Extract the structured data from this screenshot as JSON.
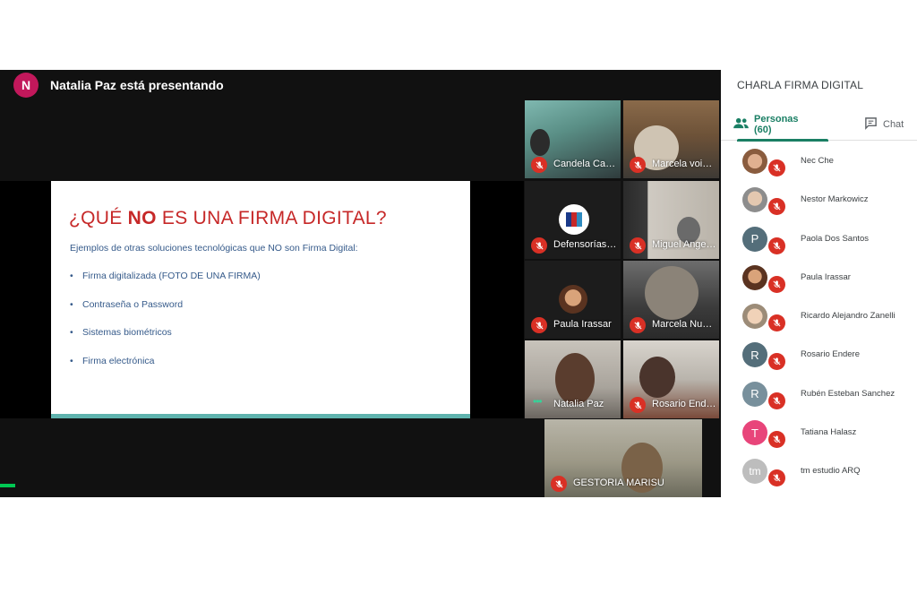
{
  "presenter": {
    "initial": "N",
    "text": "Natalia Paz está presentando",
    "avatar_color": "#c2185b"
  },
  "slide": {
    "title_prefix": "¿QUÉ ",
    "title_bold": "NO",
    "title_suffix": " ES UNA FIRMA DIGITAL?",
    "subtitle": "Ejemplos de otras soluciones tecnológicas que NO son Firma Digital:",
    "bullets": [
      "Firma digitalizada (FOTO DE UNA FIRMA)",
      "Contraseña o Password",
      "Sistemas biométricos",
      "Firma electrónica"
    ],
    "title_color": "#c62828",
    "text_color": "#355a8a",
    "footer_color": "#5fb3ae"
  },
  "tiles": [
    {
      "name": "Candela Castr...",
      "muted": true
    },
    {
      "name": "Marcela voisc...",
      "muted": true
    },
    {
      "name": "Defensorías O...",
      "muted": true
    },
    {
      "name": "Miguel Angel ...",
      "muted": true
    },
    {
      "name": "Paula Irassar",
      "muted": true
    },
    {
      "name": "Marcela Nuñez",
      "muted": true
    },
    {
      "name": "Natalia Paz",
      "muted": false
    },
    {
      "name": "Rosario Endere",
      "muted": true
    },
    {
      "name": "GESTORIA MARISU",
      "muted": true
    }
  ],
  "sidebar": {
    "meeting_title": "CHARLA FIRMA DIGITAL",
    "tab_people": "Personas (60)",
    "tab_chat": "Chat",
    "accent_color": "#1a7f64",
    "people": [
      {
        "name": "Nec Che",
        "initial": "",
        "avatar": "photo"
      },
      {
        "name": "Nestor Markowicz",
        "initial": "",
        "avatar": "photo"
      },
      {
        "name": "Paola Dos Santos",
        "initial": "P",
        "avatar": "#546e7a"
      },
      {
        "name": "Paula Irassar",
        "initial": "",
        "avatar": "photo"
      },
      {
        "name": "Ricardo Alejandro Zanelli",
        "initial": "",
        "avatar": "photo"
      },
      {
        "name": "Rosario Endere",
        "initial": "R",
        "avatar": "#546e7a"
      },
      {
        "name": "Rubén Esteban Sanchez",
        "initial": "R",
        "avatar": "#78909c"
      },
      {
        "name": "Tatiana Halasz",
        "initial": "T",
        "avatar": "#e8457a"
      },
      {
        "name": "tm estudio ARQ",
        "initial": "tm",
        "avatar": "#bdbdbd"
      }
    ]
  }
}
